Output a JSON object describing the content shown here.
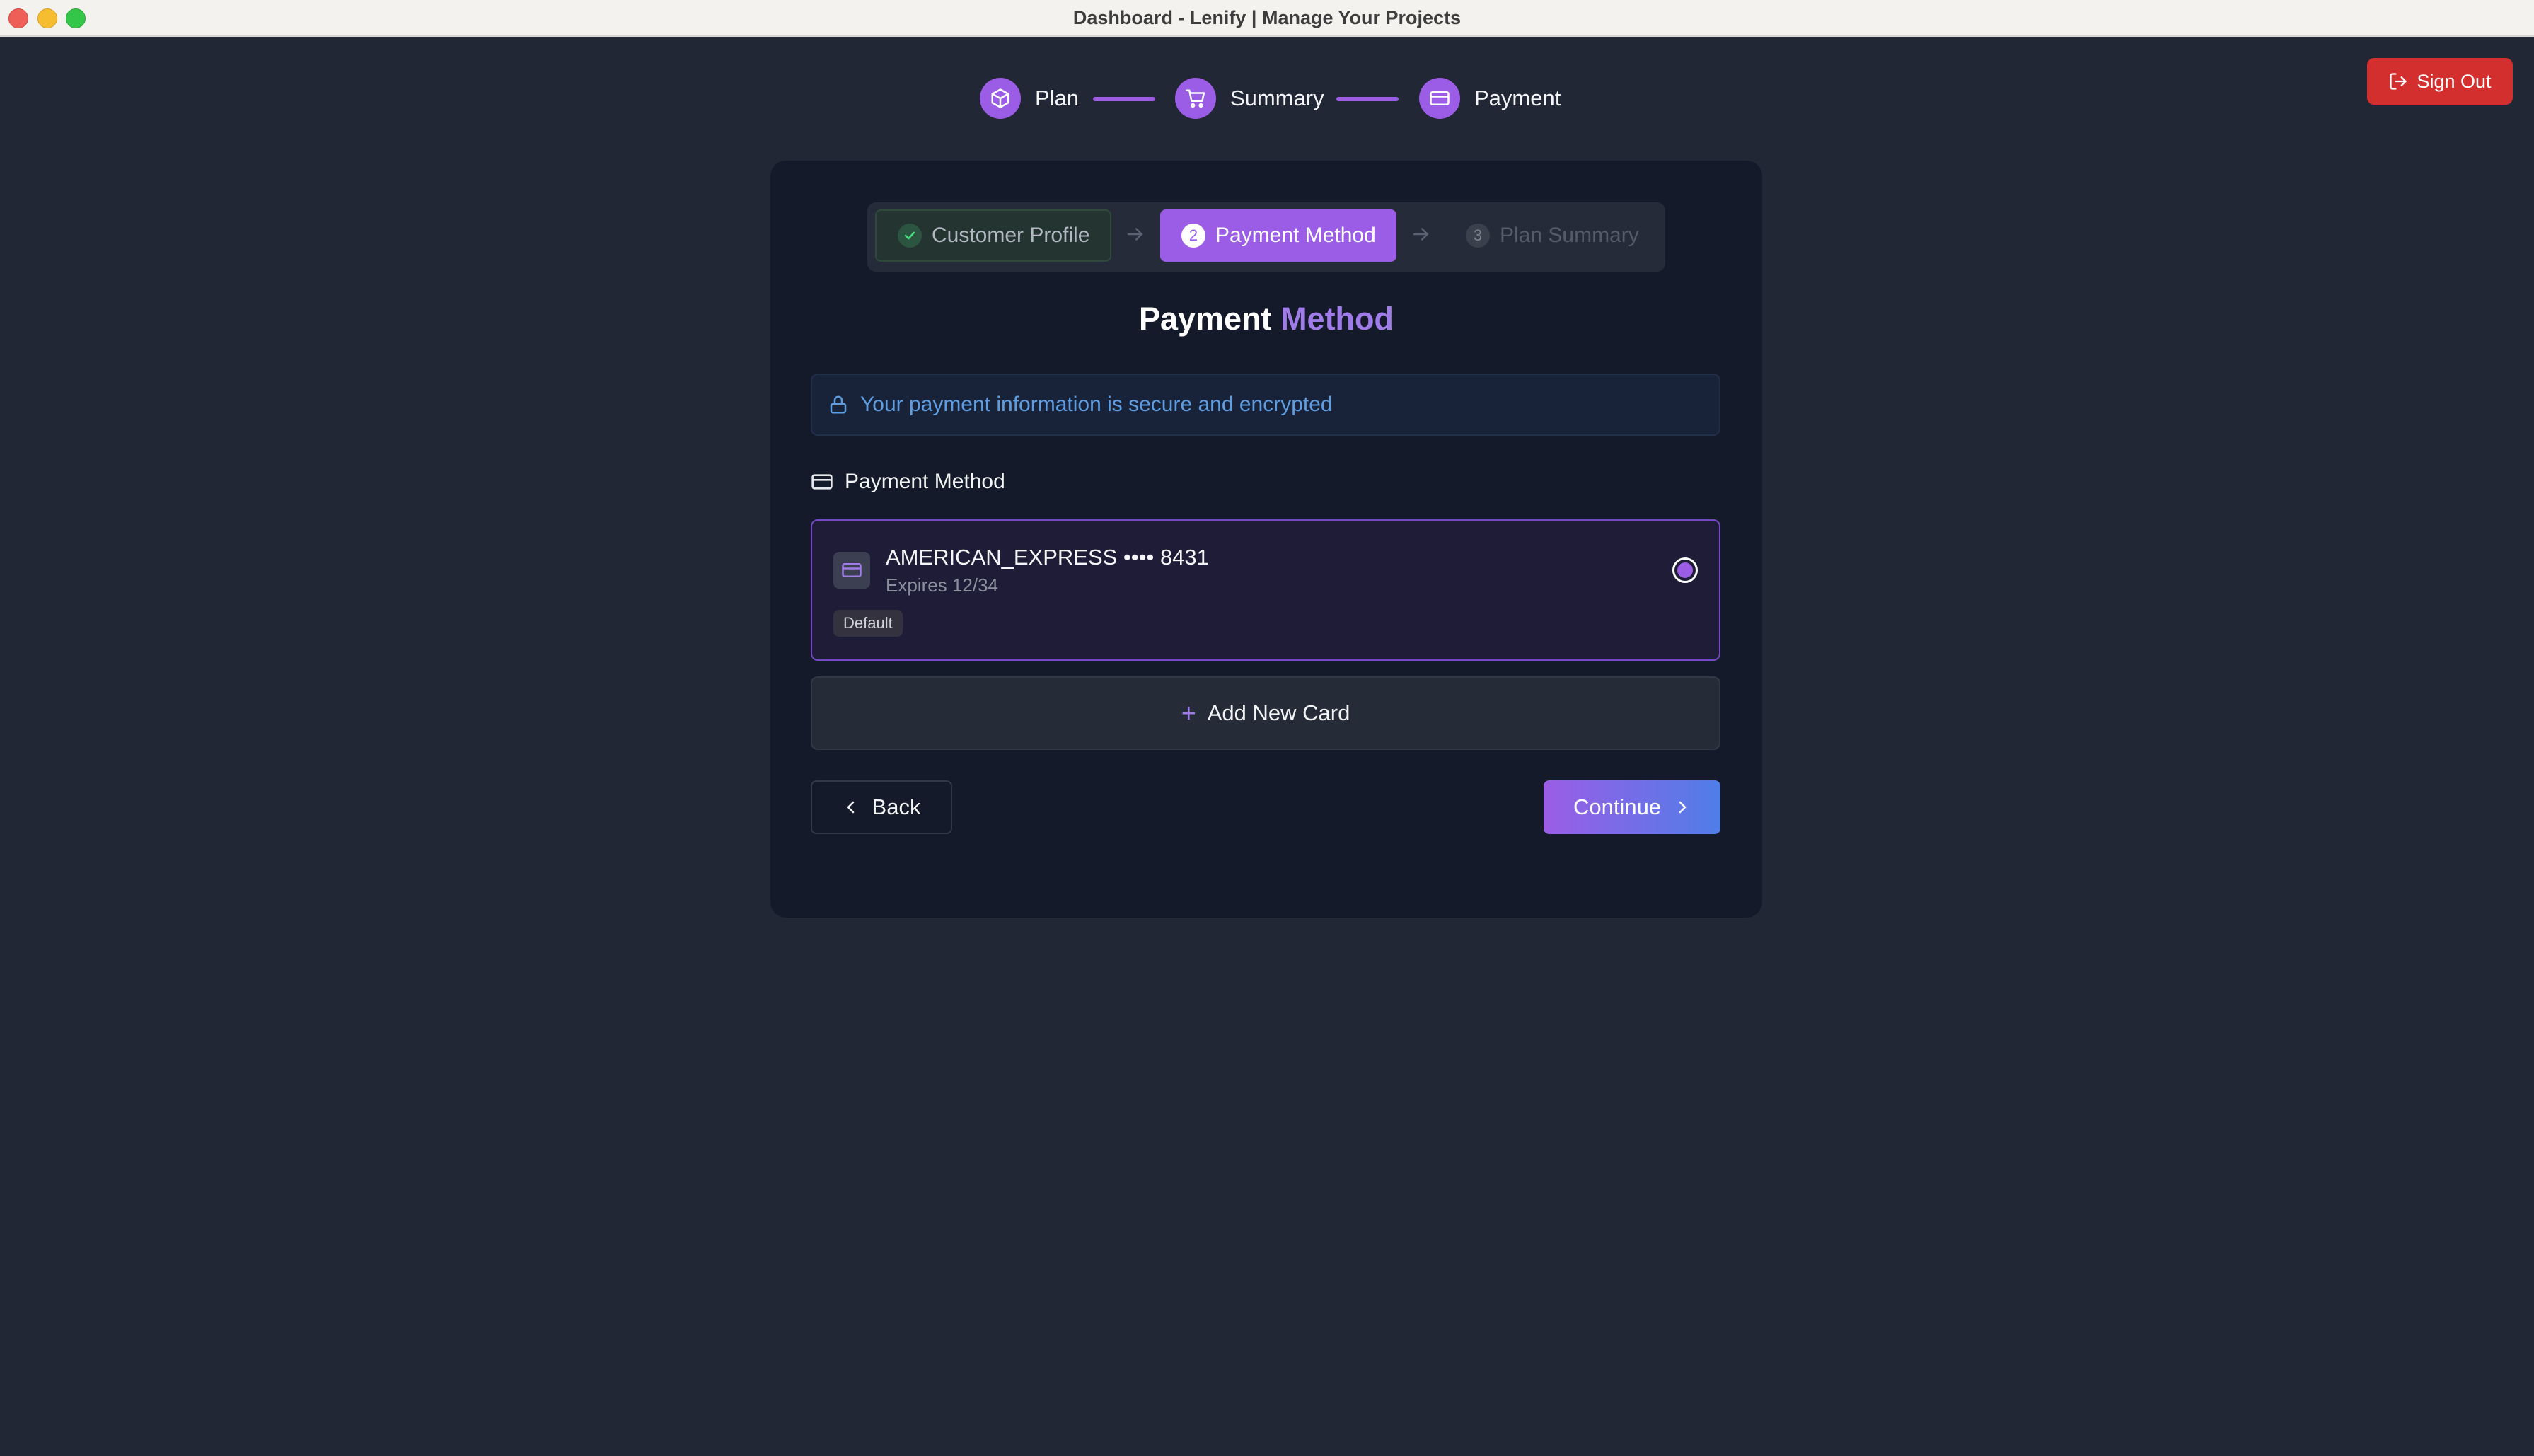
{
  "window": {
    "title": "Dashboard - Lenify | Manage Your Projects"
  },
  "header": {
    "sign_out_label": "Sign Out"
  },
  "top_stepper": {
    "steps": [
      {
        "label": "Plan",
        "icon": "box-icon"
      },
      {
        "label": "Summary",
        "icon": "cart-icon"
      },
      {
        "label": "Payment",
        "icon": "credit-card-icon"
      }
    ]
  },
  "wizard_tabs": [
    {
      "label": "Customer Profile",
      "state": "completed",
      "badge": ""
    },
    {
      "label": "Payment Method",
      "state": "active",
      "badge": "2"
    },
    {
      "label": "Plan Summary",
      "state": "pending",
      "badge": "3"
    }
  ],
  "heading": {
    "prefix": "Payment",
    "accent": "Method"
  },
  "secure_notice": "Your payment information is secure and encrypted",
  "section_label": "Payment Method",
  "saved_card": {
    "name": "AMERICAN_EXPRESS •••• 8431",
    "expires": "Expires 12/34",
    "badge": "Default",
    "selected": true
  },
  "add_card_label": "Add New Card",
  "actions": {
    "back_label": "Back",
    "continue_label": "Continue"
  },
  "colors": {
    "accent": "#9b5de5",
    "danger": "#d32f2f",
    "background": "#222735",
    "panel": "#141a29",
    "info": "#5f9de0"
  }
}
